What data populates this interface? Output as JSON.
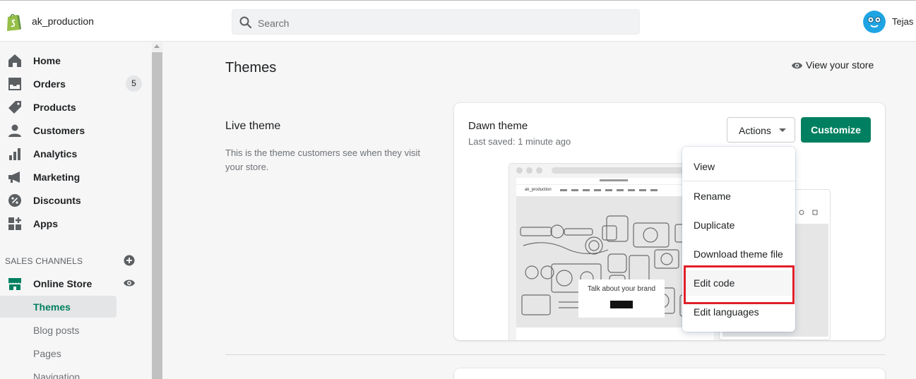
{
  "topbar": {
    "shop_name": "ak_production",
    "search_placeholder": "Search",
    "user_name": "Tejas"
  },
  "sidebar": {
    "items": [
      {
        "label": "Home",
        "icon": "home-icon"
      },
      {
        "label": "Orders",
        "icon": "orders-icon",
        "badge": "5"
      },
      {
        "label": "Products",
        "icon": "tag-icon"
      },
      {
        "label": "Customers",
        "icon": "person-icon"
      },
      {
        "label": "Analytics",
        "icon": "bar-chart-icon"
      },
      {
        "label": "Marketing",
        "icon": "megaphone-icon"
      },
      {
        "label": "Discounts",
        "icon": "discount-icon"
      },
      {
        "label": "Apps",
        "icon": "apps-icon"
      }
    ],
    "sales_channels_title": "SALES CHANNELS",
    "online_store_label": "Online Store",
    "sub_items": [
      {
        "label": "Themes",
        "active": true
      },
      {
        "label": "Blog posts"
      },
      {
        "label": "Pages"
      },
      {
        "label": "Navigation"
      }
    ]
  },
  "main": {
    "page_title": "Themes",
    "view_store_label": "View your store",
    "live_theme_heading": "Live theme",
    "live_theme_description": "This is the theme customers see when they visit your store."
  },
  "theme_card": {
    "theme_name": "Dawn theme",
    "last_saved": "Last saved: 1 minute ago",
    "actions_label": "Actions",
    "customize_label": "Customize",
    "preview_brand": "ak_production",
    "preview_hero_text": "Talk about your brand"
  },
  "actions_menu": {
    "items": [
      "View",
      "Rename",
      "Duplicate",
      "Download theme file",
      "Edit code",
      "Edit languages"
    ],
    "highlighted": "Edit code"
  },
  "colors": {
    "accent": "#008060",
    "highlight_border": "#e0202a",
    "avatar": "#1ea4e3"
  }
}
